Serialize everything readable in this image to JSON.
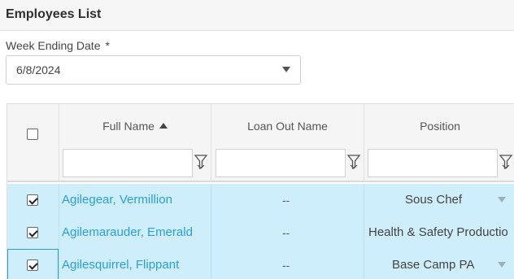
{
  "header": {
    "title": "Employees List"
  },
  "week_ending": {
    "label": "Week Ending Date",
    "required_marker": "*",
    "value": "6/8/2024"
  },
  "grid": {
    "columns": [
      {
        "label": "Full Name",
        "sort": "asc"
      },
      {
        "label": "Loan Out Name"
      },
      {
        "label": "Position"
      }
    ],
    "filters": {
      "full_name": "",
      "loan_out_name": "",
      "position": ""
    },
    "rows": [
      {
        "checked": true,
        "full_name": "Agilegear, Vermillion",
        "loan_out_name": "--",
        "position": "Sous Chef"
      },
      {
        "checked": true,
        "full_name": "Agilemarauder, Emerald",
        "loan_out_name": "--",
        "position": "Health & Safety Productio"
      },
      {
        "checked": true,
        "full_name": "Agilesquirrel, Flippant",
        "loan_out_name": "--",
        "position": "Base Camp PA"
      }
    ]
  },
  "colors": {
    "accent": "#2a9fd6",
    "row_selected": "#cdeefa",
    "header_bg": "#f5f5f5"
  },
  "icons": {
    "filter": "funnel-icon",
    "sort": "sort-ascending-icon",
    "dropdown": "caret-down-icon"
  }
}
